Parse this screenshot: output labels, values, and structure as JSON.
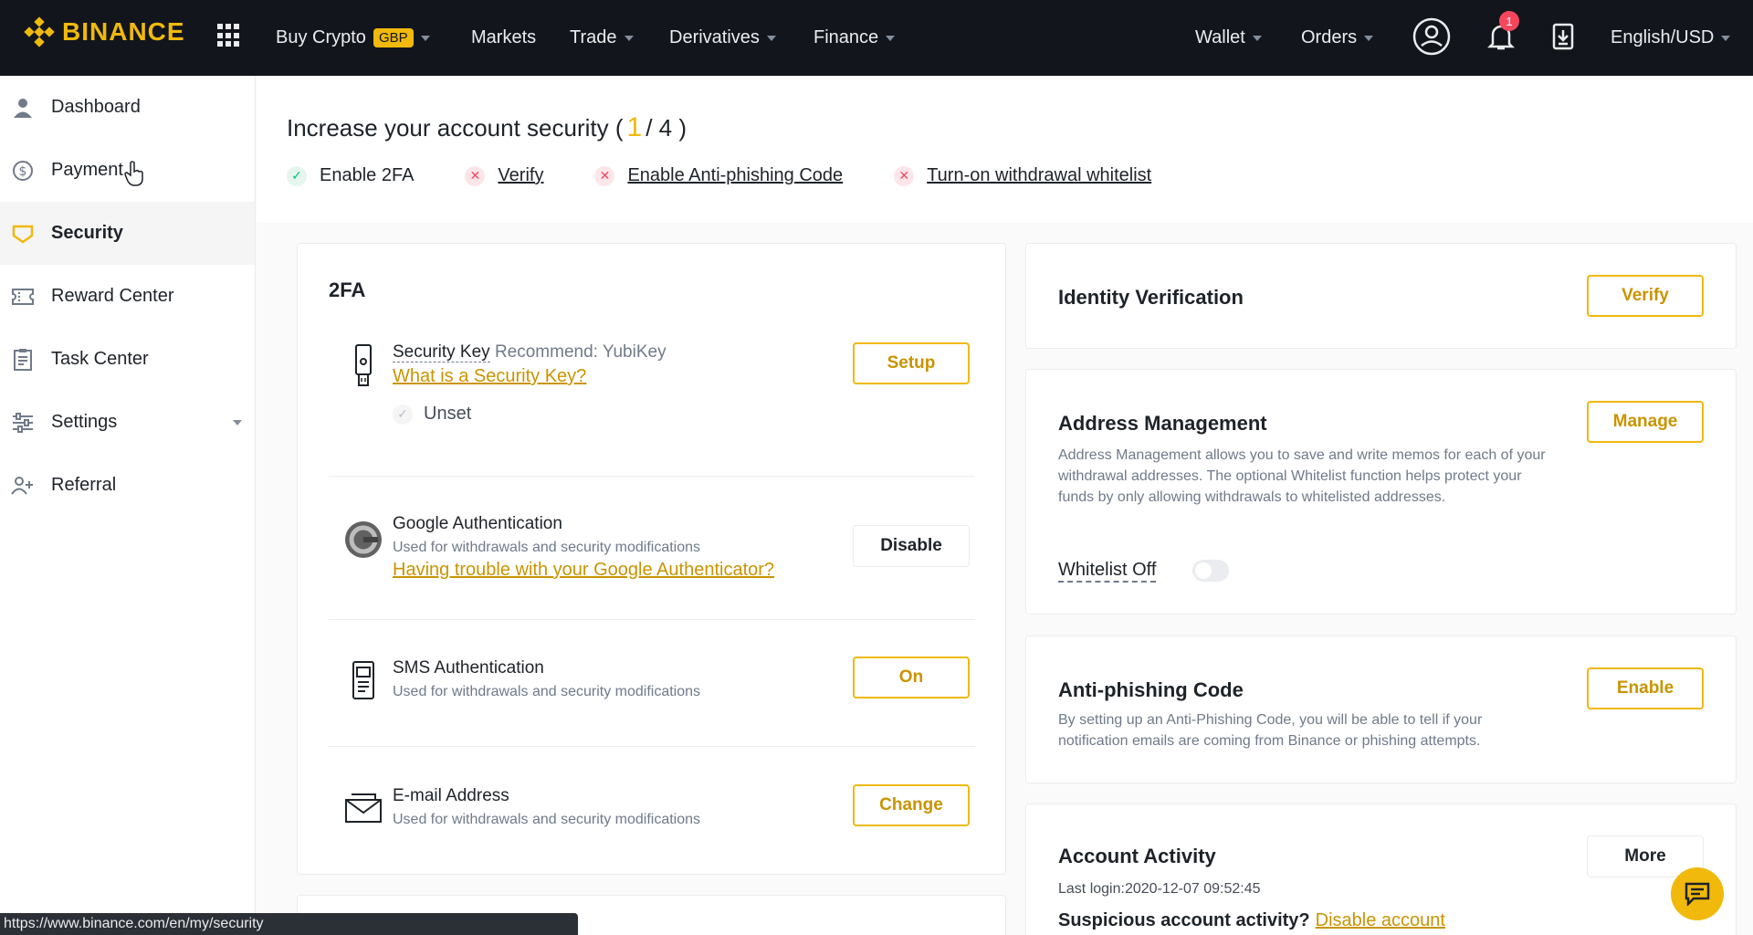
{
  "brand": {
    "name": "BINANCE",
    "color": "#f0b90b"
  },
  "nav": {
    "buy_crypto": "Buy Crypto",
    "currency_badge": "GBP",
    "markets": "Markets",
    "trade": "Trade",
    "derivatives": "Derivatives",
    "finance": "Finance",
    "wallet": "Wallet",
    "orders": "Orders",
    "notification_count": "1",
    "language": "English/USD"
  },
  "sidebar": {
    "items": [
      {
        "label": "Dashboard",
        "icon": "user-icon"
      },
      {
        "label": "Payment",
        "icon": "dollar-icon"
      },
      {
        "label": "Security",
        "icon": "shield-icon",
        "active": true
      },
      {
        "label": "Reward Center",
        "icon": "ticket-icon"
      },
      {
        "label": "Task Center",
        "icon": "clipboard-icon"
      },
      {
        "label": "Settings",
        "icon": "sliders-icon"
      },
      {
        "label": "Referral",
        "icon": "add-user-icon"
      }
    ]
  },
  "banner": {
    "title": "Increase your account security (",
    "done": "1",
    "total": "/ 4 )",
    "checks": [
      {
        "label": "Enable 2FA",
        "done": true
      },
      {
        "label": "Verify",
        "done": false
      },
      {
        "label": "Enable Anti-phishing Code",
        "done": false
      },
      {
        "label": "Turn-on withdrawal whitelist",
        "done": false
      }
    ]
  },
  "twofa": {
    "title": "2FA",
    "security_key": {
      "title": "Security Key",
      "recommend": "Recommend: YubiKey",
      "link": "What is a Security Key?",
      "status": "Unset",
      "button": "Setup"
    },
    "google": {
      "title": "Google Authentication",
      "desc": "Used for withdrawals and security modifications",
      "link": "Having trouble with your Google Authenticator?",
      "button": "Disable"
    },
    "sms": {
      "title": "SMS Authentication",
      "desc": "Used for withdrawals and security modifications",
      "button": "On"
    },
    "email": {
      "title": "E-mail Address",
      "desc": "Used for withdrawals and security modifications",
      "button": "Change"
    }
  },
  "identity": {
    "title": "Identity Verification",
    "button": "Verify"
  },
  "address": {
    "title": "Address Management",
    "desc": "Address Management allows you to save and write memos for each of your withdrawal addresses. The optional Whitelist function helps protect your funds by only allowing withdrawals to whitelisted addresses.",
    "whitelist_label": "Whitelist Off",
    "button": "Manage"
  },
  "antiphishing": {
    "title": "Anti-phishing Code",
    "desc": "By setting up an Anti-Phishing Code, you will be able to tell if your notification emails are coming from Binance or phishing attempts.",
    "button": "Enable"
  },
  "activity": {
    "title": "Account Activity",
    "last_login": "Last login:2020-12-07 09:52:45",
    "suspicious": "Suspicious account activity?",
    "disable_link": "Disable account",
    "button": "More"
  },
  "status_url": "https://www.binance.com/en/my/security"
}
